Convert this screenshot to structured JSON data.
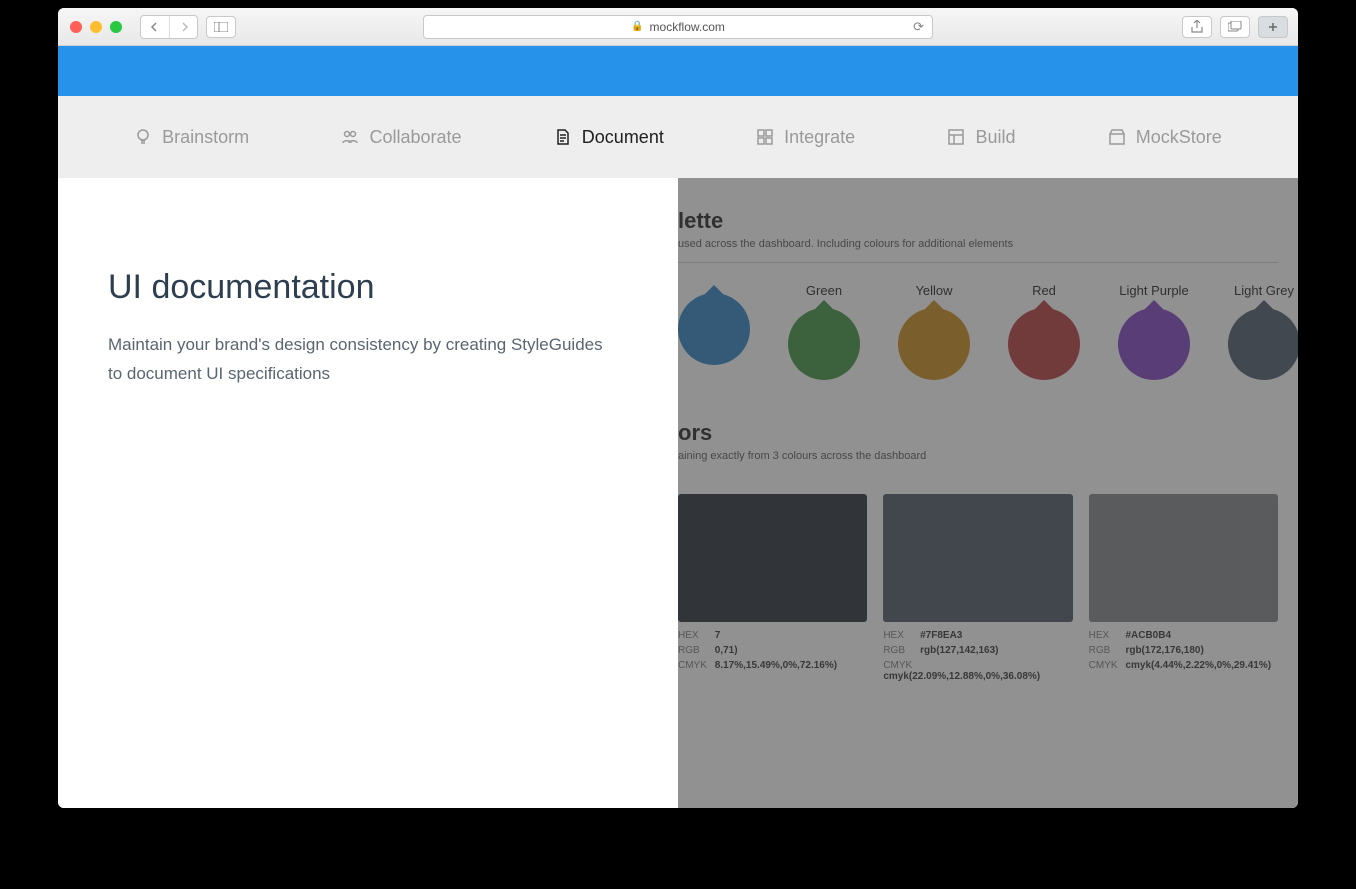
{
  "browser": {
    "url": "mockflow.com"
  },
  "tabs": [
    {
      "label": "Brainstorm",
      "active": false
    },
    {
      "label": "Collaborate",
      "active": false
    },
    {
      "label": "Document",
      "active": true
    },
    {
      "label": "Integrate",
      "active": false
    },
    {
      "label": "Build",
      "active": false
    },
    {
      "label": "MockStore",
      "active": false
    }
  ],
  "feature": {
    "title": "UI documentation",
    "description": "Maintain your brand's design consistency by creating StyleGuides to document UI specifications"
  },
  "styleguide": {
    "palette_title": "lette",
    "palette_sub": "used across the dashboard. Including colours for additional elements",
    "drops": [
      {
        "label": "",
        "color": "#2a7fbf"
      },
      {
        "label": "Green",
        "color": "#3a8f3f"
      },
      {
        "label": "Yellow",
        "color": "#c58a1a"
      },
      {
        "label": "Red",
        "color": "#b23a3a"
      },
      {
        "label": "Light Purple",
        "color": "#7a3fbf"
      },
      {
        "label": "Light Grey",
        "color": "#4a5866"
      }
    ],
    "colors_title": "ors",
    "colors_sub": "aining exactly from 3 colours across the dashboard",
    "cards": [
      {
        "hex": "7",
        "rgb": "0,71)",
        "cmyk": "8.17%,15.49%,0%,72.16%)",
        "swatch": "#242a36"
      },
      {
        "hex": "#7F8EA3",
        "rgb": "rgb(127,142,163)",
        "cmyk": "cmyk(22.09%,12.88%,0%,36.08%)",
        "swatch": "#4a5563"
      },
      {
        "hex": "#ACB0B4",
        "rgb": "rgb(172,176,180)",
        "cmyk": "cmyk(4.44%,2.22%,0%,29.41%)",
        "swatch": "#7d8184"
      }
    ]
  }
}
